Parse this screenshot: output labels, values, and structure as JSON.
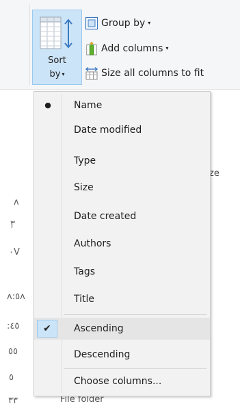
{
  "ribbon": {
    "sort_label_1": "Sort",
    "sort_label_2": "by",
    "group_by": "Group by",
    "add_columns": "Add columns",
    "size_all": "Size all columns to fit",
    "caret": "▾"
  },
  "background": {
    "size_header": "ze",
    "values": [
      "ʌ",
      "ٜ٣",
      "٠V",
      "ʌ:٥ʌ",
      ":٤٥",
      "٥٥",
      "٥",
      "٣٣"
    ],
    "type_value": "File folder"
  },
  "menu": {
    "items": [
      {
        "label": "Name",
        "mark": "●"
      },
      {
        "label": "Date modified",
        "mark": ""
      },
      {
        "label": "Type",
        "mark": ""
      },
      {
        "label": "Size",
        "mark": ""
      },
      {
        "label": "Date created",
        "mark": ""
      },
      {
        "label": "Authors",
        "mark": ""
      },
      {
        "label": "Tags",
        "mark": ""
      },
      {
        "label": "Title",
        "mark": ""
      }
    ],
    "order": [
      {
        "label": "Ascending",
        "mark": "✔"
      },
      {
        "label": "Descending",
        "mark": ""
      }
    ],
    "choose_columns": "Choose columns..."
  }
}
